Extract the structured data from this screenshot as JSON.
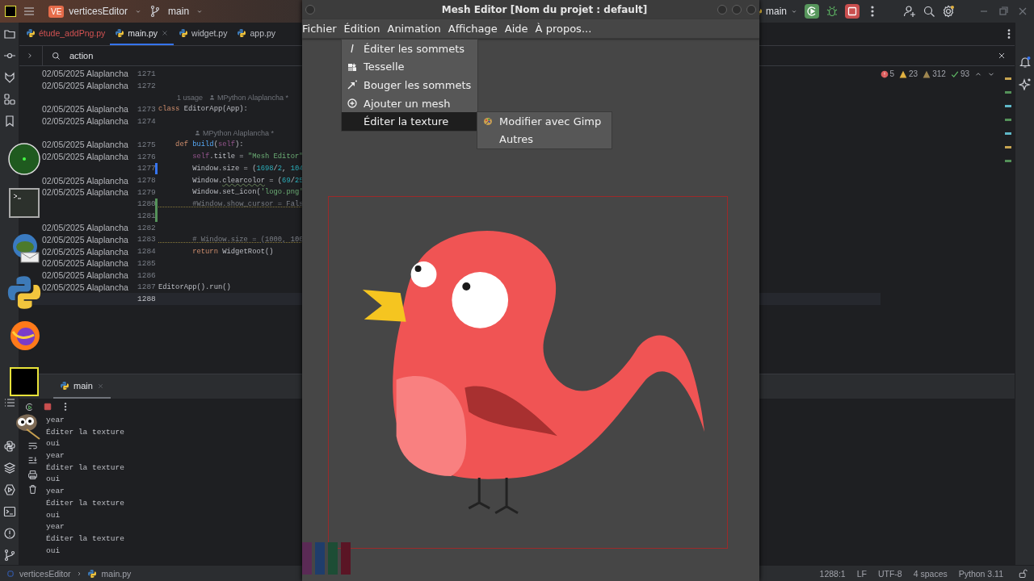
{
  "ide": {
    "project": {
      "badge": "VE",
      "name": "verticesEditor"
    },
    "branch": "main",
    "run_config": "main",
    "tabs": [
      {
        "label": "étude_addPng.py",
        "selected": false,
        "modified": true
      },
      {
        "label": "main.py",
        "selected": true,
        "modified": false
      },
      {
        "label": "widget.py",
        "selected": false,
        "modified": false
      },
      {
        "label": "app.py",
        "selected": false,
        "modified": false
      }
    ],
    "search": {
      "value": "action"
    },
    "inspections": {
      "errors": "5",
      "warnings": "23",
      "weak_warnings": "312",
      "typos": "93"
    },
    "editor_rows": [
      {
        "kind": "line",
        "blame": "02/05/2025 Alaplancha",
        "number": "1271",
        "modified": false,
        "added": false,
        "current": false
      },
      {
        "kind": "line",
        "blame": "02/05/2025 Alaplancha",
        "number": "1272",
        "modified": false,
        "added": false,
        "current": false
      },
      {
        "kind": "hint",
        "usages": "1 usage",
        "author": "MPython Alaplancha *"
      },
      {
        "kind": "line",
        "blame": "02/05/2025 Alaplancha",
        "number": "1273",
        "modified": false,
        "added": false,
        "current": false,
        "code": [
          {
            "kind": "keyword",
            "text": "class "
          },
          {
            "kind": "plain",
            "text": "EditorApp(App):"
          }
        ]
      },
      {
        "kind": "line",
        "blame": "02/05/2025 Alaplancha",
        "number": "1274",
        "modified": false,
        "added": false,
        "current": false
      },
      {
        "kind": "nested_hint",
        "author": "MPython Alaplancha *"
      },
      {
        "kind": "line",
        "blame": "02/05/2025 Alaplancha",
        "number": "1275",
        "modified": false,
        "added": false,
        "current": false,
        "code": [
          {
            "kind": "keyword",
            "text": "    def "
          },
          {
            "kind": "function",
            "text": "build"
          },
          {
            "kind": "plain",
            "text": "("
          },
          {
            "kind": "self",
            "text": "self"
          },
          {
            "kind": "plain",
            "text": "):"
          }
        ]
      },
      {
        "kind": "line",
        "blame": "02/05/2025 Alaplancha",
        "number": "1276",
        "modified": false,
        "added": false,
        "current": false,
        "code": [
          {
            "kind": "self",
            "text": "        self"
          },
          {
            "kind": "plain",
            "text": ".title = "
          },
          {
            "kind": "string",
            "text": "\"Mesh Editor\""
          }
        ]
      },
      {
        "kind": "line",
        "number": "1277",
        "modified": true,
        "added": false,
        "current": false,
        "code": [
          {
            "kind": "plain",
            "text": "        Window.size = ("
          },
          {
            "kind": "number",
            "text": "1698"
          },
          {
            "kind": "plain",
            "text": "/"
          },
          {
            "kind": "number",
            "text": "2"
          },
          {
            "kind": "plain",
            "text": ", "
          },
          {
            "kind": "number",
            "text": "104"
          }
        ]
      },
      {
        "kind": "line",
        "blame": "02/05/2025 Alaplancha",
        "number": "1278",
        "modified": false,
        "added": false,
        "current": false,
        "code": [
          {
            "kind": "plain",
            "text": "        Window."
          },
          {
            "kind": "warning",
            "text": "clearcolor"
          },
          {
            "kind": "plain",
            "text": " = ("
          },
          {
            "kind": "number",
            "text": "69"
          },
          {
            "kind": "plain",
            "text": "/"
          },
          {
            "kind": "number",
            "text": "25"
          }
        ]
      },
      {
        "kind": "line",
        "blame": "02/05/2025 Alaplancha",
        "number": "1279",
        "modified": false,
        "added": false,
        "current": false,
        "code": [
          {
            "kind": "plain",
            "text": "        Window.set_icon("
          },
          {
            "kind": "string",
            "text": "'logo.png'"
          }
        ]
      },
      {
        "kind": "line",
        "number": "1280",
        "modified": false,
        "added": true,
        "current": false,
        "code": [
          {
            "kind": "comment",
            "text": "        #Window.show_cursor = Fals"
          }
        ]
      },
      {
        "kind": "line",
        "number": "1281",
        "modified": false,
        "added": true,
        "current": false
      },
      {
        "kind": "line",
        "blame": "02/05/2025 Alaplancha",
        "number": "1282",
        "modified": false,
        "added": false,
        "current": false
      },
      {
        "kind": "line",
        "blame": "02/05/2025 Alaplancha",
        "number": "1283",
        "modified": false,
        "added": false,
        "current": false,
        "code": [
          {
            "kind": "comment",
            "text": "        # Window.size = (1000, 100"
          }
        ]
      },
      {
        "kind": "line",
        "blame": "02/05/2025 Alaplancha",
        "number": "1284",
        "modified": false,
        "added": false,
        "current": false,
        "code": [
          {
            "kind": "keyword",
            "text": "        return "
          },
          {
            "kind": "plain",
            "text": "WidgetRoot()"
          }
        ]
      },
      {
        "kind": "line",
        "blame": "02/05/2025 Alaplancha",
        "number": "1285",
        "modified": false,
        "added": false,
        "current": false
      },
      {
        "kind": "line",
        "blame": "02/05/2025 Alaplancha",
        "number": "1286",
        "modified": false,
        "added": false,
        "current": false
      },
      {
        "kind": "line",
        "blame": "02/05/2025 Alaplancha",
        "number": "1287",
        "modified": false,
        "added": false,
        "current": false,
        "code": [
          {
            "kind": "plain",
            "text": "EditorApp().run()"
          }
        ]
      },
      {
        "kind": "line",
        "number": "1288",
        "modified": false,
        "added": false,
        "current": true
      }
    ],
    "console": {
      "tab": "main",
      "lines": [
        "year",
        "Éditer la texture",
        "oui",
        "year",
        "Éditer la texture",
        "oui",
        "year",
        "Éditer la texture",
        "oui",
        "year",
        "Éditer la texture",
        "oui"
      ]
    },
    "status_bar": {
      "breadcrumb": [
        "verticesEditor",
        "main.py"
      ],
      "items": [
        "1288:1",
        "LF",
        "UTF-8",
        "4 spaces",
        "Python 3.11"
      ]
    }
  },
  "mesh_editor": {
    "title": "Mesh Editor [Nom du projet : default]",
    "menus": [
      "Fichier",
      "Édition",
      "Animation",
      "Affichage",
      "Aide",
      "À propos..."
    ],
    "dropdown": [
      {
        "label": "Éditer les sommets",
        "kind": "edit",
        "selected": false
      },
      {
        "label": "Tesselle",
        "kind": "tessellate",
        "selected": false
      },
      {
        "label": "Bouger les sommets",
        "kind": "move",
        "selected": false
      },
      {
        "label": "Ajouter un mesh",
        "kind": "add",
        "selected": false
      },
      {
        "label": "Éditer la texture",
        "kind": "none",
        "selected": true
      }
    ],
    "submenu": [
      {
        "label": "Modifier avec Gimp",
        "kind": "gimp"
      },
      {
        "label": "Autres",
        "kind": "none"
      }
    ],
    "swatches": [
      {
        "color": "#5a2a55"
      },
      {
        "color": "#1f3d6b"
      },
      {
        "color": "#1d4d35"
      },
      {
        "color": "#5a1525"
      }
    ]
  }
}
